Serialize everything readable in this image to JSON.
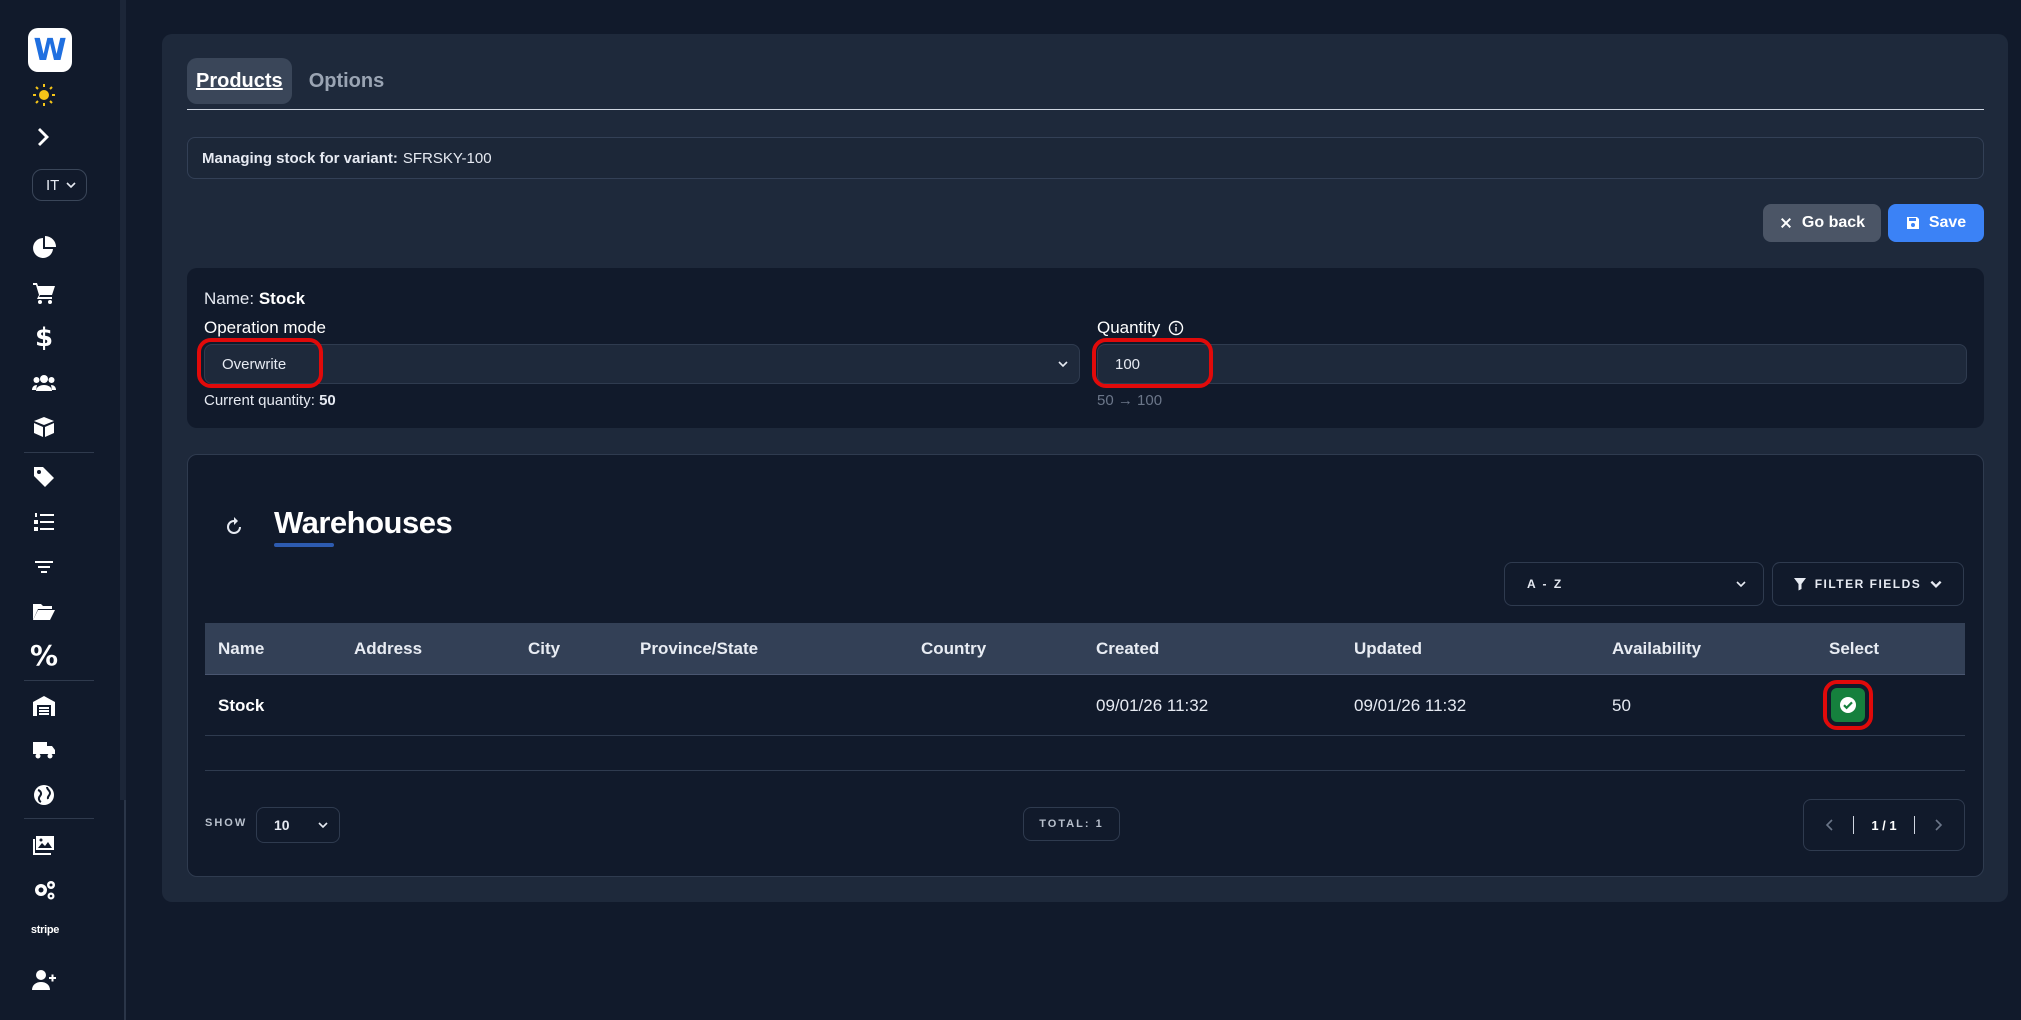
{
  "sidebar": {
    "logo_letter": "W",
    "language": "IT",
    "stripe_label": "stripe",
    "icons": [
      "sun-icon",
      "chevron-right-icon",
      "chart-pie-icon",
      "cart-icon",
      "dollar-icon",
      "users-icon",
      "box-icon",
      "tags-icon",
      "list-ordered-icon",
      "filter-icon",
      "folder-open-icon",
      "percent-icon",
      "warehouse-icon",
      "truck-icon",
      "globe-icon",
      "images-icon",
      "gears-icon",
      "user-plus-icon"
    ]
  },
  "tabs": [
    {
      "label": "Products",
      "active": true
    },
    {
      "label": "Options",
      "active": false
    }
  ],
  "variant": {
    "label": "Managing stock for variant:",
    "code": "SFRSKY-100"
  },
  "toolbar": {
    "back_label": "Go back",
    "save_label": "Save"
  },
  "stock": {
    "name_label": "Name:",
    "name_value": "Stock",
    "operation_label": "Operation mode",
    "operation_value": "Overwrite",
    "current_label": "Current quantity:",
    "current_value": "50",
    "quantity_label": "Quantity",
    "quantity_value": "100",
    "change_preview": "50 → 100"
  },
  "warehouses": {
    "title": "Warehouses",
    "sort_value": "A - Z",
    "filter_label": "FILTER FIELDS",
    "columns": [
      "Name",
      "Address",
      "City",
      "Province/State",
      "Country",
      "Created",
      "Updated",
      "Availability",
      "Select"
    ],
    "rows": [
      {
        "name": "Stock",
        "address": "",
        "city": "",
        "province": "",
        "country": "",
        "created": "09/01/26 11:32",
        "updated": "09/01/26 11:32",
        "availability": "50",
        "selected": true
      }
    ],
    "show_label": "SHOW",
    "page_size": "10",
    "total_label": "TOTAL: 1",
    "pagination": "1 / 1"
  },
  "colors": {
    "accent": "#3b82f6",
    "success": "#15803d",
    "highlight": "#e10a0a"
  }
}
